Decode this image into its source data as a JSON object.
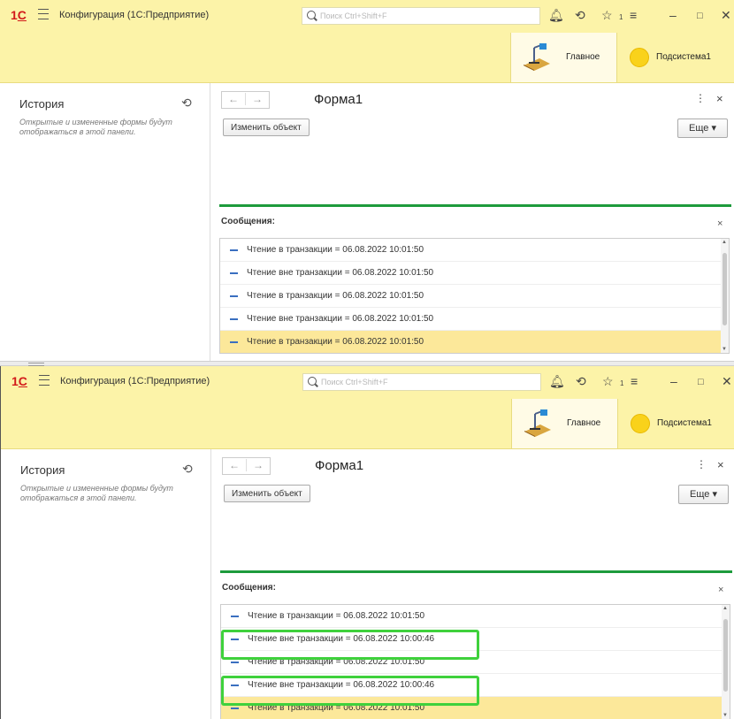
{
  "windows": [
    {
      "app": {
        "logo": "1С",
        "title": "Конфигурация  (1С:Предприятие)",
        "search_placeholder": "Поиск Ctrl+Shift+F",
        "notifications_count": "1"
      },
      "sections": [
        {
          "label": "Главное",
          "icon": "desk-lamp-icon"
        },
        {
          "label": "Подсистема1",
          "icon": "sun-icon"
        }
      ],
      "history": {
        "title": "История",
        "text": "Открытые и измененные формы будут отображаться в этой панели."
      },
      "form": {
        "title": "Форма1",
        "edit_button": "Изменить объект",
        "more_button": "Еще ▾"
      },
      "messages": {
        "title": "Сообщения:",
        "items": [
          "Чтение в транзакции = 06.08.2022 10:01:50",
          "Чтение вне транзакции = 06.08.2022 10:01:50",
          "Чтение в транзакции = 06.08.2022 10:01:50",
          "Чтение вне транзакции = 06.08.2022 10:01:50",
          "Чтение в транзакции = 06.08.2022 10:01:50"
        ],
        "selected_index": 4
      }
    },
    {
      "app": {
        "logo": "1С",
        "title": "Конфигурация  (1С:Предприятие)",
        "search_placeholder": "Поиск Ctrl+Shift+F",
        "notifications_count": "1"
      },
      "sections": [
        {
          "label": "Главное",
          "icon": "desk-lamp-icon"
        },
        {
          "label": "Подсистема1",
          "icon": "sun-icon"
        }
      ],
      "history": {
        "title": "История",
        "text": "Открытые и измененные формы будут отображаться в этой панели."
      },
      "form": {
        "title": "Форма1",
        "edit_button": "Изменить объект",
        "more_button": "Еще ▾"
      },
      "messages": {
        "title": "Сообщения:",
        "items": [
          "Чтение в транзакции = 06.08.2022 10:01:50",
          "Чтение вне транзакции = 06.08.2022 10:00:46",
          "Чтение в транзакции = 06.08.2022 10:01:50",
          "Чтение вне транзакции = 06.08.2022 10:00:46",
          "Чтение в транзакции = 06.08.2022 10:01:50"
        ],
        "selected_index": 4,
        "highlighted_indices": [
          1,
          3
        ],
        "highlight_color": "#3fd13c"
      }
    }
  ],
  "colors": {
    "toolbar_bg": "#fcf3a8",
    "accent_green": "#1d9b3c",
    "selected_row": "#fce89a",
    "logo_red": "#d21a1a"
  }
}
